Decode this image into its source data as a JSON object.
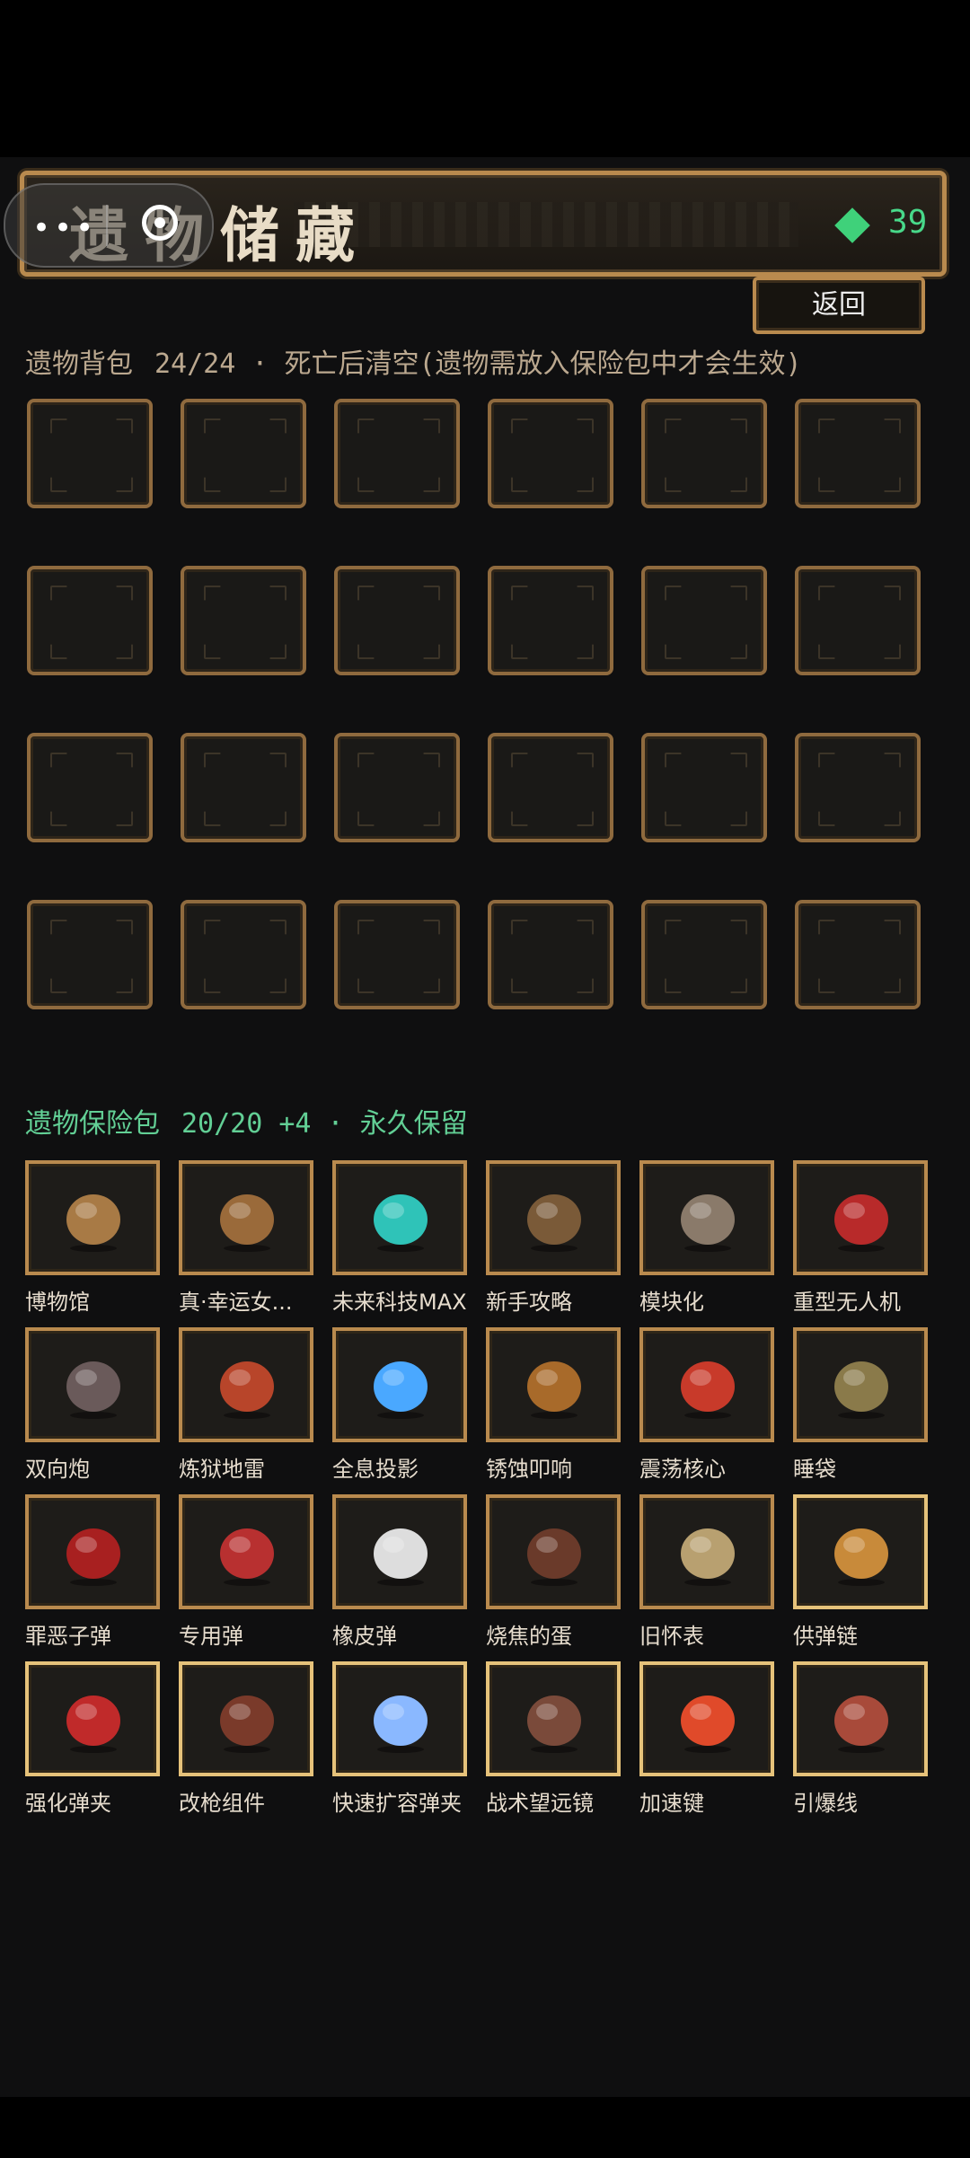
{
  "title": "遗物储藏",
  "gems": "39",
  "back_label": "返回",
  "backpack": {
    "title": "遗物背包",
    "info": "24/24 · 死亡后清空(遗物需放入保险包中才会生效)",
    "slots": 24
  },
  "vault": {
    "title": "遗物保险包",
    "info": "20/20 +4 · 永久保留",
    "items": [
      {
        "label": "博物馆",
        "icon": "museum-icon",
        "color": "#a87a45"
      },
      {
        "label": "真·幸运女...",
        "icon": "statue-icon",
        "color": "#9a6a3a"
      },
      {
        "label": "未来科技MAX",
        "icon": "tech-core-icon",
        "color": "#2fc3b8"
      },
      {
        "label": "新手攻略",
        "icon": "book-icon",
        "color": "#7a5a38"
      },
      {
        "label": "模块化",
        "icon": "module-icon",
        "color": "#8a7a6a"
      },
      {
        "label": "重型无人机",
        "icon": "drone-icon",
        "color": "#b82a2a"
      },
      {
        "label": "双向炮",
        "icon": "mace-icon",
        "color": "#6a5a5a"
      },
      {
        "label": "炼狱地雷",
        "icon": "mine-icon",
        "color": "#b8452a"
      },
      {
        "label": "全息投影",
        "icon": "hologram-icon",
        "color": "#4aa8ff"
      },
      {
        "label": "锈蚀叩响",
        "icon": "bell-icon",
        "color": "#a86a2a"
      },
      {
        "label": "震荡核心",
        "icon": "core-icon",
        "color": "#c83a2a"
      },
      {
        "label": "睡袋",
        "icon": "sleeping-bag-icon",
        "color": "#8a7a4a"
      },
      {
        "label": "罪恶子弹",
        "icon": "shell-icon",
        "color": "#a82020"
      },
      {
        "label": "专用弹",
        "icon": "bullet-icon",
        "color": "#b83030"
      },
      {
        "label": "橡皮弹",
        "icon": "rubber-bullet-icon",
        "color": "#dddddd"
      },
      {
        "label": "烧焦的蛋",
        "icon": "egg-icon",
        "color": "#6a3a2a"
      },
      {
        "label": "旧怀表",
        "icon": "pocket-watch-icon",
        "color": "#b8a070"
      },
      {
        "label": "供弹链",
        "icon": "ammo-belt-icon",
        "color": "#c88a3a"
      },
      {
        "label": "强化弹夹",
        "icon": "magazine-icon",
        "color": "#c02a2a"
      },
      {
        "label": "改枪组件",
        "icon": "gun-parts-icon",
        "color": "#7a3a2a"
      },
      {
        "label": "快速扩容弹夹",
        "icon": "fast-magazine-icon",
        "color": "#8ab8ff"
      },
      {
        "label": "战术望远镜",
        "icon": "binoculars-icon",
        "color": "#7a4a3a"
      },
      {
        "label": "加速键",
        "icon": "speed-key-icon",
        "color": "#e04a2a"
      },
      {
        "label": "引爆线",
        "icon": "fuse-wire-icon",
        "color": "#a84a3a"
      }
    ]
  }
}
